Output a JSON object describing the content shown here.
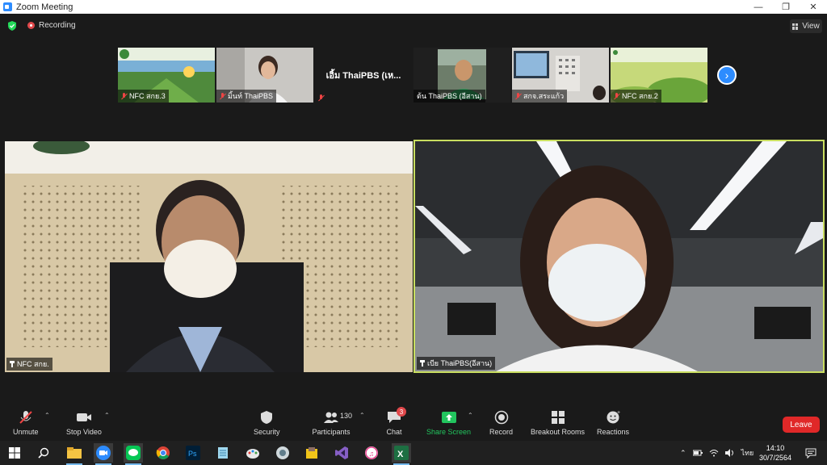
{
  "window": {
    "title": "Zoom Meeting"
  },
  "status": {
    "recording_label": "Recording",
    "view_label": "View"
  },
  "strip": [
    {
      "name": "NFC สกย.3",
      "muted": true
    },
    {
      "name": "มิ้นท์ ThaiPBS",
      "muted": true
    },
    {
      "display_text": "เอิ้ม ThaiPBS (เห...",
      "muted": true
    },
    {
      "name": "ต้น ThaiPBS (อีสาน)",
      "muted": false
    },
    {
      "name": "สกจ.สระแก้ว",
      "muted": true
    },
    {
      "name": "NFC สกย.2",
      "muted": true
    }
  ],
  "videos": {
    "left_name": "NFC สกย.",
    "right_name": "เบีย ThaiPBS(อีสาน)",
    "active_speaker_border": "#c9de60"
  },
  "toolbar": {
    "unmute": "Unmute",
    "stop_video": "Stop Video",
    "security": "Security",
    "participants": "Participants",
    "participants_count": "130",
    "chat": "Chat",
    "chat_badge": "3",
    "share_screen": "Share Screen",
    "record": "Record",
    "breakout_rooms": "Breakout Rooms",
    "reactions": "Reactions",
    "leave": "Leave"
  },
  "taskbar": {
    "time": "14:10",
    "date": "30/7/2564",
    "language": "ไทย",
    "apps": [
      "windows-start-icon",
      "search-icon",
      "file-explorer-icon",
      "zoom-icon",
      "line-icon",
      "chrome-icon",
      "photoshop-icon",
      "notepad-icon",
      "paint-icon",
      "app-icon",
      "game-icon",
      "visual-studio-icon",
      "itunes-icon",
      "excel-icon"
    ]
  }
}
